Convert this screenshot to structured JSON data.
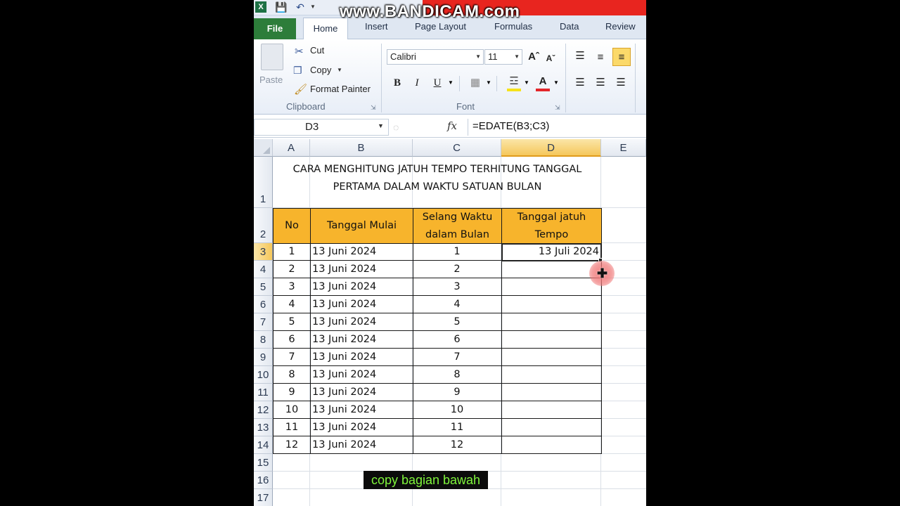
{
  "watermark": "www.BANDICAM.com",
  "ribbon_tabs": [
    "File",
    "Home",
    "Insert",
    "Page Layout",
    "Formulas",
    "Data",
    "Review"
  ],
  "clipboard": {
    "paste": "Paste",
    "cut": "Cut",
    "copy": "Copy",
    "format_painter": "Format Painter",
    "group_label": "Clipboard"
  },
  "font": {
    "name": "Calibri",
    "size": "11",
    "group_label": "Font",
    "bold": "B",
    "italic": "I",
    "underline": "U"
  },
  "formula_bar": {
    "name_box": "D3",
    "fx": "fx",
    "formula": "=EDATE(B3;C3)"
  },
  "sheet": {
    "columns": [
      "A",
      "B",
      "C",
      "D",
      "E"
    ],
    "row_numbers": [
      "1",
      "2",
      "3",
      "4",
      "5",
      "6",
      "7",
      "8",
      "9",
      "10",
      "11",
      "12",
      "13",
      "14",
      "15",
      "16",
      "17"
    ],
    "title_line1": "CARA MENGHITUNG JATUH TEMPO TERHITUNG TANGGAL",
    "title_line2": "PERTAMA DALAM WAKTU  SATUAN BULAN",
    "headers": {
      "no": "No",
      "start": "Tanggal Mulai",
      "interval_line1": "Selang Waktu",
      "interval_line2": "dalam Bulan",
      "due_line1": "Tanggal jatuh",
      "due_line2": "Tempo"
    },
    "rows": [
      {
        "no": "1",
        "start": "13 Juni 2024",
        "interval": "1",
        "due": "13 Juli 2024"
      },
      {
        "no": "2",
        "start": "13 Juni 2024",
        "interval": "2",
        "due": ""
      },
      {
        "no": "3",
        "start": "13 Juni 2024",
        "interval": "3",
        "due": ""
      },
      {
        "no": "4",
        "start": "13 Juni 2024",
        "interval": "4",
        "due": ""
      },
      {
        "no": "5",
        "start": "13 Juni 2024",
        "interval": "5",
        "due": ""
      },
      {
        "no": "6",
        "start": "13 Juni 2024",
        "interval": "6",
        "due": ""
      },
      {
        "no": "7",
        "start": "13 Juni 2024",
        "interval": "7",
        "due": ""
      },
      {
        "no": "8",
        "start": "13 Juni 2024",
        "interval": "8",
        "due": ""
      },
      {
        "no": "9",
        "start": "13 Juni 2024",
        "interval": "9",
        "due": ""
      },
      {
        "no": "10",
        "start": "13 Juni 2024",
        "interval": "10",
        "due": ""
      },
      {
        "no": "11",
        "start": "13 Juni 2024",
        "interval": "11",
        "due": ""
      },
      {
        "no": "12",
        "start": "13 Juni 2024",
        "interval": "12",
        "due": ""
      }
    ]
  },
  "caption": "copy bagian bawah",
  "colors": {
    "header_fill": "#f7b42c",
    "file_tab": "#2d7d3a",
    "caption_text": "#7ff43b",
    "watermark_bar": "#e8251f"
  }
}
